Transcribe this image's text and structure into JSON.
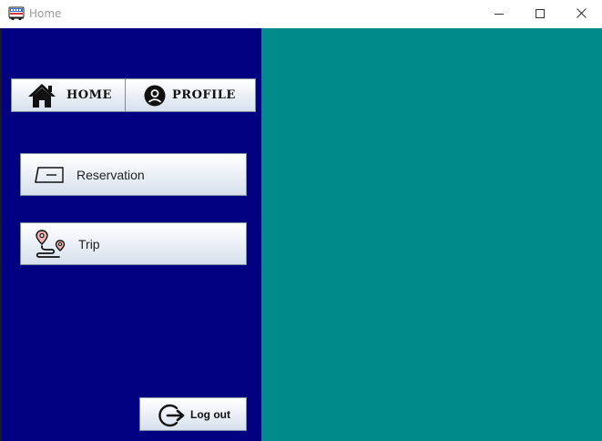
{
  "window": {
    "title": "Home",
    "icons": {
      "app": "bus-icon",
      "minimize": "minimize-icon",
      "maximize": "maximize-icon",
      "close": "close-icon"
    }
  },
  "colors": {
    "sidebar_bg": "#000080",
    "content_bg": "#008B8B",
    "button_top": "#FFFFFF",
    "button_bottom": "#D6E0EC"
  },
  "nav": {
    "home": {
      "label": "HOME",
      "icon": "home-icon"
    },
    "profile": {
      "label": "PROFILE",
      "icon": "user-circle-icon"
    }
  },
  "menu": [
    {
      "label": "Reservation",
      "icon": "ticket-icon"
    },
    {
      "label": "Trip",
      "icon": "route-pin-icon"
    }
  ],
  "logout": {
    "label": "Log out",
    "icon": "logout-icon"
  }
}
